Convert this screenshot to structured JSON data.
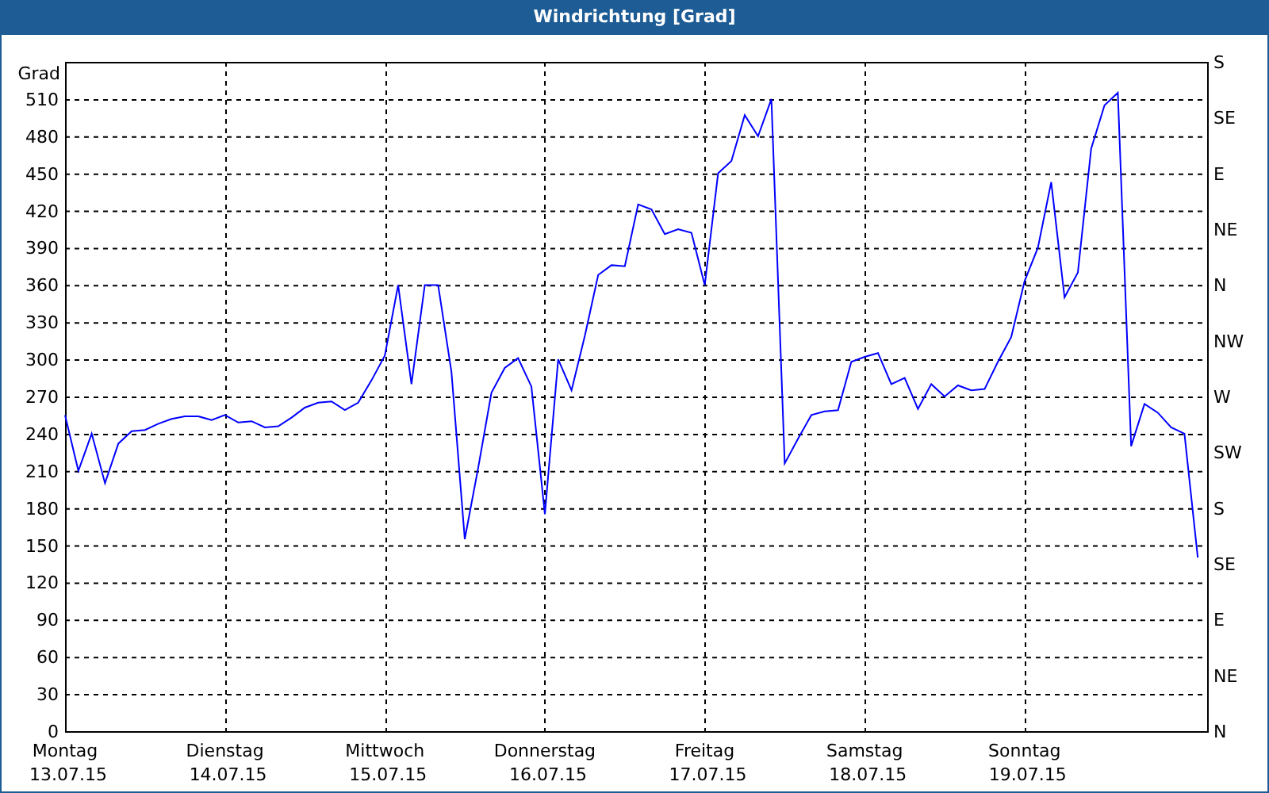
{
  "window": {
    "title": "Windrichtung [Grad]"
  },
  "chart": {
    "chart_data": {
      "type": "line",
      "grid": true,
      "ylabel": "Grad",
      "ylim": [
        0,
        540
      ],
      "yticks": [
        0,
        30,
        60,
        90,
        120,
        150,
        180,
        210,
        240,
        270,
        300,
        330,
        360,
        390,
        420,
        450,
        480,
        510
      ],
      "categories": [
        "Montag",
        null,
        null,
        null,
        null,
        null,
        null,
        null,
        null,
        null,
        null,
        null,
        "Dienstag",
        null,
        null,
        null,
        null,
        null,
        null,
        null,
        null,
        null,
        null,
        null,
        "Mittwoch",
        null,
        null,
        null,
        null,
        null,
        null,
        null,
        null,
        null,
        null,
        null,
        "Donnerstag",
        null,
        null,
        null,
        null,
        null,
        null,
        null,
        null,
        null,
        null,
        null,
        "Freitag",
        null,
        null,
        null,
        null,
        null,
        null,
        null,
        null,
        null,
        null,
        null,
        "Samstag",
        null,
        null,
        null,
        null,
        null,
        null,
        null,
        null,
        null,
        null,
        null,
        "Sonntag",
        null,
        null,
        null,
        null,
        null,
        null,
        null,
        null,
        null,
        null,
        null,
        null,
        null
      ],
      "series": [
        {
          "color": "#0000ff",
          "values": [
            255,
            210,
            240,
            200,
            232,
            242,
            243,
            248,
            252,
            254,
            254,
            251,
            255,
            249,
            250,
            245,
            246,
            253,
            261,
            265,
            266,
            259,
            265,
            283,
            303,
            360,
            280,
            360,
            360,
            290,
            155,
            212,
            273,
            293,
            301,
            278,
            175,
            300,
            275,
            319,
            368,
            376,
            375,
            425,
            421,
            401,
            405,
            402,
            360,
            450,
            460,
            497,
            480,
            510,
            216,
            236,
            255,
            258,
            259,
            298,
            302,
            305,
            280,
            285,
            260,
            280,
            270,
            279,
            275,
            276,
            298,
            318,
            363,
            390,
            443,
            350,
            370,
            470,
            505,
            515,
            230,
            264,
            257,
            245,
            240,
            140
          ]
        }
      ]
    },
    "day_dates": [
      "13.07.15",
      "14.07.15",
      "15.07.15",
      "16.07.15",
      "17.07.15",
      "18.07.15",
      "19.07.15"
    ],
    "direction_labels": [
      "S",
      "SE",
      "E",
      "NE",
      "N",
      "NW",
      "W",
      "SW",
      "S",
      "SE",
      "E",
      "NE",
      "N"
    ]
  }
}
